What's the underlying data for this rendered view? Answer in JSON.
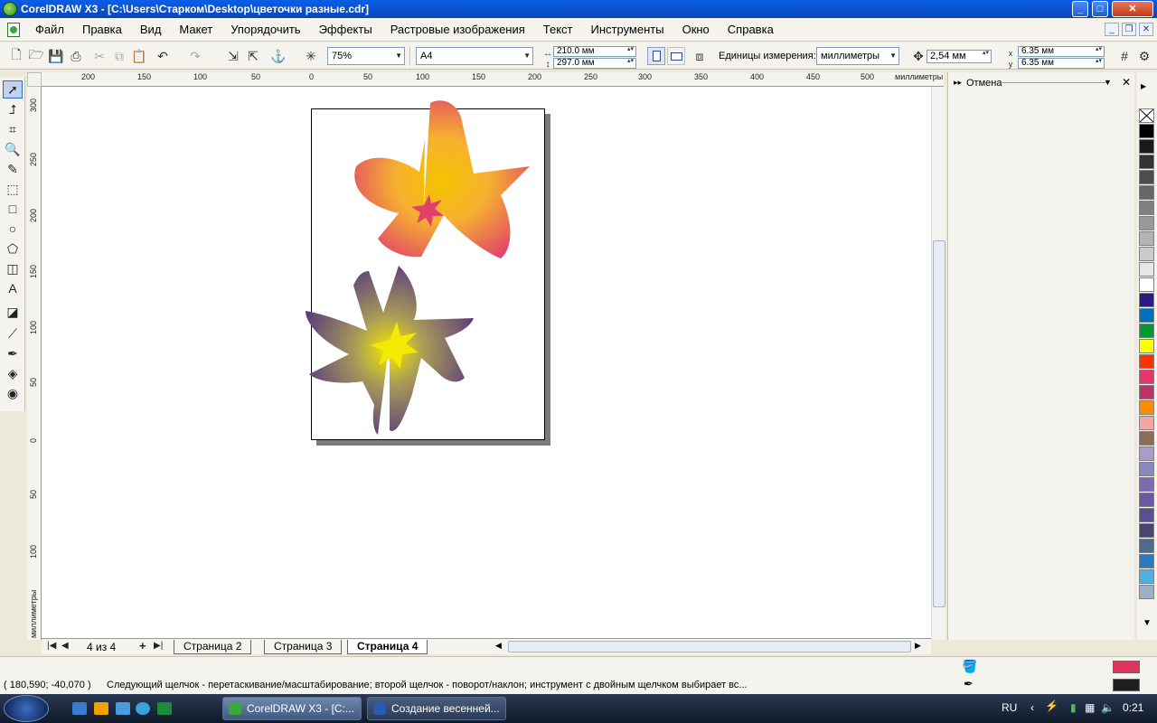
{
  "window": {
    "title": "CorelDRAW X3 - [C:\\Users\\Старком\\Desktop\\цветочки разные.cdr]"
  },
  "menu": {
    "items": [
      "Файл",
      "Правка",
      "Вид",
      "Макет",
      "Упорядочить",
      "Эффекты",
      "Растровые изображения",
      "Текст",
      "Инструменты",
      "Окно",
      "Справка"
    ]
  },
  "propbar": {
    "zoom": "75%",
    "paper": "A4",
    "width": "210.0 мм",
    "height": "297.0 мм",
    "units_label": "Единицы измерения:",
    "units": "миллиметры",
    "nudge": "2,54 мм",
    "dup_x": "6.35 мм",
    "dup_y": "6.35 мм"
  },
  "ruler": {
    "h_labels": [
      "200",
      "150",
      "100",
      "50",
      "0",
      "50",
      "100",
      "150",
      "200",
      "250",
      "300",
      "350",
      "400",
      "450",
      "500",
      "миллиметры"
    ],
    "v_labels": [
      "300",
      "250",
      "200",
      "150",
      "100",
      "50",
      "0",
      "50",
      "100",
      "миллиметры"
    ]
  },
  "docker": {
    "title": "Отмена"
  },
  "palette": {
    "colors": [
      "#000000",
      "#1a1a1a",
      "#333333",
      "#4d4d4d",
      "#666666",
      "#808080",
      "#999999",
      "#b3b3b3",
      "#cccccc",
      "#e6e6e6",
      "#ffffff",
      "#2e1a87",
      "#0070c0",
      "#009933",
      "#ffff00",
      "#ff3300",
      "#e8336d",
      "#c0306a",
      "#ff8c00",
      "#f4a6a0",
      "#8c6e58",
      "#a89cc8",
      "#8a86c0",
      "#7a6ab4",
      "#6a58a4",
      "#5a4e94",
      "#4a4474",
      "#506a8a",
      "#2a7ac0",
      "#4ab0e6",
      "#9ab0c8"
    ]
  },
  "pages": {
    "counter": "4 из 4",
    "tabs": [
      "Страница 2",
      "Страница 3",
      "Страница 4"
    ],
    "active": "Страница 4"
  },
  "status": {
    "coords": "( 180,590; -40,070 )",
    "message": "Следующий щелчок - перетаскивание/масштабирование; второй щелчок - поворот/наклон; инструмент с двойным щелчком выбирает вс...",
    "fill_color": "#e0345f",
    "outline_color": "#1e1e1e"
  },
  "taskbar": {
    "tasks": [
      "CorelDRAW X3 - [C:...",
      "Создание весенней..."
    ],
    "lang": "RU",
    "clock": "0:21"
  }
}
